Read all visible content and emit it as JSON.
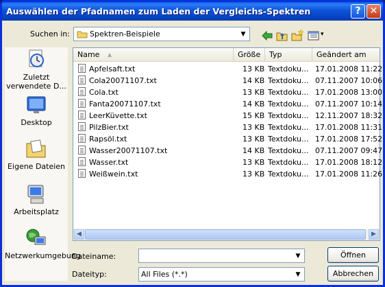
{
  "window": {
    "title": "Auswählen der Pfadnamen zum Laden der Vergleichs-Spektren",
    "help_glyph": "?",
    "close_glyph": "✕"
  },
  "lookin": {
    "label": "Suchen in:",
    "value": "Spektren-Beispiele"
  },
  "toolbar": {
    "back_icon": "back-arrow-icon",
    "up_icon": "folder-up-icon",
    "new_folder_icon": "new-folder-icon",
    "view_icon": "view-menu-icon",
    "view_arrow": "▾"
  },
  "places": [
    {
      "label": "Zuletzt verwendete D...",
      "icon": "recent-documents-icon"
    },
    {
      "label": "Desktop",
      "icon": "desktop-icon"
    },
    {
      "label": "Eigene Dateien",
      "icon": "my-documents-icon"
    },
    {
      "label": "Arbeitsplatz",
      "icon": "my-computer-icon"
    },
    {
      "label": "Netzwerkumgebung",
      "icon": "network-icon"
    }
  ],
  "columns": {
    "name": "Name",
    "size": "Größe",
    "type": "Typ",
    "modified": "Geändert am",
    "sort_glyph": "▲"
  },
  "files": [
    {
      "name": "Apfelsaft.txt",
      "size": "13 KB",
      "type": "Textdoku...",
      "modified": "17.01.2008 11:22"
    },
    {
      "name": "Cola20071107.txt",
      "size": "14 KB",
      "type": "Textdoku...",
      "modified": "07.11.2007 10:06"
    },
    {
      "name": "Cola.txt",
      "size": "13 KB",
      "type": "Textdoku...",
      "modified": "17.01.2008 13:00"
    },
    {
      "name": "Fanta20071107.txt",
      "size": "14 KB",
      "type": "Textdoku...",
      "modified": "07.11.2007 10:14"
    },
    {
      "name": "LeerKüvette.txt",
      "size": "15 KB",
      "type": "Textdoku...",
      "modified": "12.11.2007 18:32"
    },
    {
      "name": "PilzBier.txt",
      "size": "13 KB",
      "type": "Textdoku...",
      "modified": "17.01.2008 11:31"
    },
    {
      "name": "Rapsöl.txt",
      "size": "13 KB",
      "type": "Textdoku...",
      "modified": "17.01.2008 17:52"
    },
    {
      "name": "Wasser20071107.txt",
      "size": "14 KB",
      "type": "Textdoku...",
      "modified": "07.11.2007 09:47"
    },
    {
      "name": "Wasser.txt",
      "size": "13 KB",
      "type": "Textdoku...",
      "modified": "17.01.2008 18:12"
    },
    {
      "name": "Weißwein.txt",
      "size": "13 KB",
      "type": "Textdoku...",
      "modified": "17.01.2008 11:26"
    }
  ],
  "scroll": {
    "left": "◀",
    "right": "▶"
  },
  "filename": {
    "label": "Dateiname:",
    "value": ""
  },
  "filetype": {
    "label": "Dateityp:",
    "value": "All Files (*.*)"
  },
  "buttons": {
    "open": "Öffnen",
    "cancel": "Abbrechen"
  },
  "dropdown_glyph": "▼"
}
